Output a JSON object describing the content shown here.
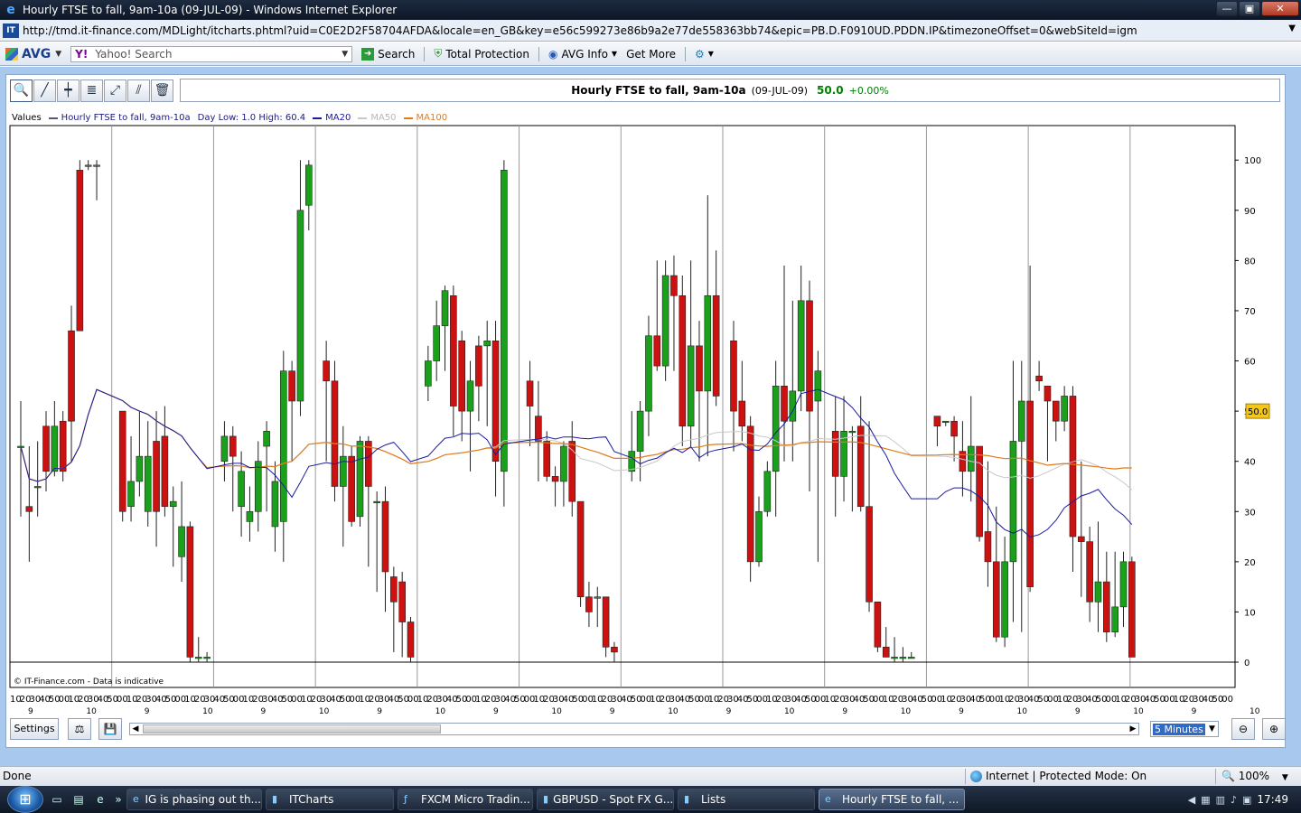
{
  "window": {
    "title": "Hourly FTSE to fall, 9am-10a (09-JUL-09) - Windows Internet Explorer",
    "url": "http://tmd.it-finance.com/MDLight/itcharts.phtml?uid=C0E2D2F58704AFDA&locale=en_GB&key=e56c599273e86b9a2e77de558363bb74&epic=PB.D.F0910UD.PDDN.IP&timezoneOffset=0&webSiteId=igm"
  },
  "avg_toolbar": {
    "logo": "AVG",
    "search_placeholder": "Yahoo! Search",
    "search_button": "Search",
    "total_protection": "Total Protection",
    "avg_info": "AVG Info",
    "get_more": "Get More",
    "yahoo_label": "Y!"
  },
  "chart_header": {
    "title": "Hourly FTSE to fall, 9am-10a",
    "date": "(09-JUL-09)",
    "price": "50.0",
    "change": "+0.00%"
  },
  "legend": {
    "values_label": "Values",
    "series_label": "Hourly FTSE to fall, 9am-10a",
    "day_range": "Day Low: 1.0 High: 60.4",
    "ma20": "MA20",
    "ma50": "MA50",
    "ma100": "MA100"
  },
  "colors": {
    "up": "#1aa01a",
    "down": "#cc1111",
    "ma20": "#1a1aa0",
    "ma50": "#c8c8c8",
    "ma100": "#e07b1a",
    "price_tag_bg": "#f5c518"
  },
  "copyright": "© IT-Finance.com - Data is indicative",
  "controls": {
    "settings": "Settings",
    "interval": "5 Minutes"
  },
  "statusbar": {
    "left": "Done",
    "zone": "Internet | Protected Mode: On",
    "zoom": "100%"
  },
  "taskbar": {
    "items": [
      {
        "label": "IG is phasing out th...",
        "icon": "ie-icon"
      },
      {
        "label": "ITCharts",
        "icon": "chart-icon"
      },
      {
        "label": "FXCM Micro Tradin...",
        "icon": "fx-icon"
      },
      {
        "label": "GBPUSD - Spot FX G...",
        "icon": "chart-icon"
      },
      {
        "label": "Lists",
        "icon": "chart-icon"
      },
      {
        "label": "Hourly FTSE to fall, ...",
        "icon": "ie-icon"
      }
    ],
    "clock": "17:49"
  },
  "chart_data": {
    "type": "candlestick",
    "ylim": [
      0,
      104
    ],
    "y_ticks": [
      0,
      10,
      20,
      30,
      40,
      50,
      60,
      70,
      80,
      90,
      100
    ],
    "current_price": 50.0,
    "x_tick_labels": [
      "10",
      "20",
      "30",
      "40",
      "50",
      "00",
      "10",
      "20",
      "30",
      "40",
      "50",
      "00",
      "10",
      "20",
      "30",
      "40",
      "50",
      "00",
      "10",
      "20",
      "30",
      "40",
      "50",
      "00",
      "10",
      "20",
      "30",
      "40",
      "50",
      "00",
      "10",
      "20",
      "30",
      "40",
      "50",
      "00",
      "10",
      "20",
      "30",
      "40",
      "50",
      "00",
      "10",
      "20",
      "30",
      "40",
      "50",
      "00",
      "10",
      "20",
      "30",
      "40",
      "50",
      "00",
      "10",
      "20",
      "30",
      "40",
      "50",
      "00",
      "10",
      "20",
      "30",
      "40",
      "50",
      "00",
      "10",
      "20",
      "30",
      "40",
      "50",
      "00",
      "10",
      "20",
      "30",
      "40",
      "50",
      "00",
      "10",
      "20",
      "30",
      "40",
      "50",
      "00",
      "10",
      "20",
      "30",
      "40",
      "50",
      "00",
      "10",
      "20",
      "30",
      "40",
      "50",
      "00",
      "10",
      "20",
      "30",
      "40",
      "50",
      "00",
      "10",
      "20",
      "30",
      "40",
      "50",
      "00",
      "10",
      "20",
      "30",
      "40",
      "50",
      "00",
      "10",
      "20",
      "30",
      "40",
      "50",
      "00",
      "10",
      "20",
      "30",
      "40",
      "50",
      "00"
    ],
    "hour_labels": [
      "9",
      "10",
      "9",
      "10",
      "9",
      "10",
      "9",
      "10",
      "9",
      "10",
      "9",
      "10",
      "9",
      "10",
      "9",
      "10",
      "9",
      "10",
      "9",
      "10",
      "9",
      "10",
      "9"
    ],
    "segments": [
      {
        "candles": [
          [
            43,
            43,
            52,
            29
          ],
          [
            31,
            30,
            43,
            20
          ],
          [
            35,
            35,
            44,
            29
          ],
          [
            47,
            38,
            50,
            34
          ],
          [
            38,
            47,
            52,
            37
          ],
          [
            48,
            38,
            50,
            36
          ],
          [
            66,
            48,
            71,
            40
          ],
          [
            98,
            66,
            100,
            66
          ],
          [
            99,
            99,
            100,
            98
          ],
          [
            99,
            99,
            100,
            92
          ]
        ]
      },
      {
        "candles": [
          [
            50,
            30,
            50,
            28
          ],
          [
            31,
            36,
            45,
            28
          ],
          [
            36,
            41,
            50,
            33
          ],
          [
            30,
            41,
            48,
            27
          ],
          [
            44,
            30,
            50,
            23
          ],
          [
            45,
            31,
            51,
            29
          ],
          [
            31,
            32,
            35,
            19
          ],
          [
            21,
            27,
            36,
            16
          ],
          [
            27,
            1,
            28,
            0
          ],
          [
            1,
            1,
            5,
            0
          ],
          [
            1,
            1,
            2,
            0
          ]
        ]
      },
      {
        "candles": [
          [
            40,
            45,
            48,
            36
          ],
          [
            45,
            41,
            47,
            30
          ],
          [
            31,
            38,
            42,
            25
          ],
          [
            28,
            30,
            35,
            24
          ],
          [
            30,
            40,
            44,
            26
          ],
          [
            43,
            46,
            48,
            30
          ],
          [
            27,
            36,
            40,
            22
          ],
          [
            28,
            58,
            62,
            20
          ],
          [
            58,
            52,
            60,
            40
          ],
          [
            52,
            90,
            100,
            49
          ],
          [
            91,
            99,
            100,
            86
          ]
        ]
      },
      {
        "candles": [
          [
            60,
            56,
            64,
            40
          ],
          [
            56,
            35,
            60,
            32
          ],
          [
            35,
            41,
            47,
            23
          ],
          [
            41,
            28,
            43,
            27
          ],
          [
            29,
            44,
            45,
            27
          ],
          [
            44,
            35,
            45,
            19
          ],
          [
            32,
            32,
            34,
            14
          ],
          [
            32,
            18,
            35,
            10
          ],
          [
            17,
            12,
            19,
            2
          ],
          [
            16,
            8,
            18,
            1
          ],
          [
            8,
            1,
            9,
            0
          ]
        ]
      },
      {
        "candles": [
          [
            55,
            60,
            63,
            52
          ],
          [
            60,
            67,
            72,
            56
          ],
          [
            67,
            74,
            75,
            58
          ],
          [
            73,
            51,
            75,
            45
          ],
          [
            64,
            50,
            66,
            44
          ],
          [
            50,
            56,
            60,
            38
          ],
          [
            63,
            55,
            65,
            48
          ],
          [
            63,
            64,
            68,
            47
          ],
          [
            64,
            40,
            68,
            33
          ],
          [
            38,
            98,
            100,
            31
          ]
        ]
      },
      {
        "candles": [
          [
            56,
            51,
            60,
            43
          ],
          [
            49,
            44,
            56,
            36
          ],
          [
            44,
            37,
            46,
            36
          ],
          [
            37,
            36,
            39,
            31
          ],
          [
            36,
            43,
            44,
            31
          ],
          [
            44,
            32,
            48,
            29
          ],
          [
            32,
            13,
            32,
            11
          ],
          [
            13,
            10,
            16,
            7
          ],
          [
            13,
            13,
            15,
            7
          ],
          [
            13,
            3,
            13,
            1
          ],
          [
            3,
            2,
            4,
            0
          ]
        ]
      },
      {
        "candles": [
          [
            38,
            42,
            50,
            36
          ],
          [
            42,
            50,
            52,
            36
          ],
          [
            50,
            65,
            69,
            45
          ],
          [
            65,
            59,
            80,
            58
          ],
          [
            59,
            77,
            80,
            56
          ],
          [
            77,
            73,
            81,
            58
          ],
          [
            73,
            47,
            77,
            43
          ],
          [
            47,
            63,
            80,
            43
          ],
          [
            63,
            54,
            68,
            40
          ],
          [
            54,
            73,
            93,
            41
          ],
          [
            73,
            53,
            82,
            51
          ]
        ]
      },
      {
        "candles": [
          [
            64,
            50,
            68,
            42
          ],
          [
            52,
            47,
            60,
            44
          ],
          [
            47,
            20,
            49,
            16
          ],
          [
            20,
            30,
            33,
            19
          ],
          [
            30,
            38,
            40,
            29
          ],
          [
            38,
            55,
            60,
            29
          ],
          [
            55,
            48,
            79,
            40
          ],
          [
            48,
            54,
            72,
            40
          ],
          [
            54,
            72,
            79,
            50
          ],
          [
            72,
            50,
            76,
            34
          ],
          [
            52,
            58,
            62,
            20
          ]
        ]
      },
      {
        "candles": [
          [
            46,
            37,
            53,
            29
          ],
          [
            37,
            46,
            53,
            32
          ],
          [
            46,
            46,
            47,
            30
          ],
          [
            47,
            31,
            53,
            30
          ],
          [
            31,
            12,
            48,
            10
          ],
          [
            12,
            3,
            12,
            2
          ],
          [
            3,
            1,
            7,
            1
          ],
          [
            1,
            1,
            5,
            0
          ],
          [
            1,
            1,
            3,
            0
          ],
          [
            1,
            1,
            2,
            1
          ]
        ]
      },
      {
        "candles": [
          [
            49,
            47,
            47,
            43
          ],
          [
            48,
            48,
            48,
            47
          ],
          [
            48,
            45,
            49,
            40
          ],
          [
            42,
            38,
            48,
            33
          ],
          [
            38,
            43,
            53,
            32
          ],
          [
            43,
            25,
            43,
            24
          ],
          [
            26,
            20,
            40,
            15
          ],
          [
            20,
            5,
            31,
            4
          ],
          [
            5,
            20,
            25,
            3
          ],
          [
            20,
            44,
            60,
            8
          ],
          [
            44,
            52,
            60,
            6
          ],
          [
            52,
            15,
            79,
            14
          ]
        ]
      },
      {
        "candles": [
          [
            57,
            56,
            60,
            54
          ],
          [
            55,
            52,
            54,
            40
          ],
          [
            52,
            48,
            50,
            44
          ],
          [
            48,
            53,
            55,
            46
          ],
          [
            53,
            25,
            55,
            18
          ],
          [
            25,
            24,
            40,
            13
          ],
          [
            24,
            12,
            27,
            8
          ],
          [
            12,
            16,
            28,
            6
          ],
          [
            16,
            6,
            22,
            4
          ],
          [
            6,
            11,
            22,
            5
          ],
          [
            11,
            20,
            22,
            7
          ],
          [
            20,
            1,
            21,
            1
          ]
        ]
      }
    ],
    "ma_series": {
      "ma20_note": "MA20 moving average",
      "ma50_note": "MA50 moving average",
      "ma100_note": "MA100 moving average"
    }
  }
}
